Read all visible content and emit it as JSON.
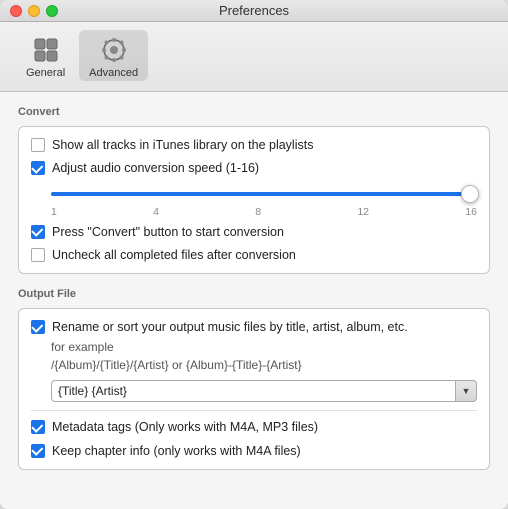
{
  "window": {
    "title": "Preferences"
  },
  "toolbar": {
    "general_label": "General",
    "advanced_label": "Advanced"
  },
  "convert_section": {
    "label": "Convert",
    "checkboxes": [
      {
        "id": "show-tracks",
        "label": "Show all tracks in iTunes library on the playlists",
        "checked": false
      },
      {
        "id": "adjust-speed",
        "label": "Adjust audio conversion speed (1-16)",
        "checked": true
      },
      {
        "id": "press-convert",
        "label": "Press \"Convert\" button to start conversion",
        "checked": true
      },
      {
        "id": "uncheck-completed",
        "label": "Uncheck all completed files after conversion",
        "checked": false
      }
    ],
    "slider": {
      "marks": [
        "1",
        "4",
        "8",
        "12",
        "16"
      ],
      "value": 16
    }
  },
  "output_section": {
    "label": "Output File",
    "rename_label": "Rename or sort your output music files by title, artist, album, etc.",
    "example_label": "for example",
    "example_format": "/{Album}/{Title}/{Artist} or {Album}-{Title}-{Artist}",
    "format_value": "{Title} {Artist}",
    "checkboxes": [
      {
        "id": "metadata-tags",
        "label": "Metadata tags (Only works with M4A, MP3 files)",
        "checked": true
      },
      {
        "id": "chapter-info",
        "label": "Keep chapter info (only works with  M4A files)",
        "checked": true
      }
    ]
  }
}
